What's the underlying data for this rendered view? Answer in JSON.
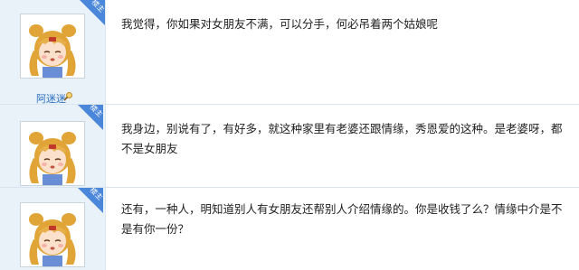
{
  "thread": {
    "posts": [
      {
        "badge": "楼主",
        "username": "阿迷迷",
        "text": "我觉得，你如果对女朋友不满，可以分手，何必吊着两个姑娘呢"
      },
      {
        "badge": "楼主",
        "text": "我身边，别说有了，有好多，就这种家里有老婆还跟情缘，秀恩爱的这种。是老婆呀，都不是女朋友"
      },
      {
        "badge": "楼主",
        "text": "还有，一种人，明知道别人有女朋友还帮别人介绍情缘的。你是收钱了么？情缘中介是不是有你一份？"
      }
    ]
  },
  "colors": {
    "badge": "#4a86d9",
    "author_panel": "#e9f1f9",
    "username": "#2a6fbf"
  },
  "icons": {
    "avatar": "anime-girl-avatar-icon",
    "user_search": "magnifier-icon"
  }
}
